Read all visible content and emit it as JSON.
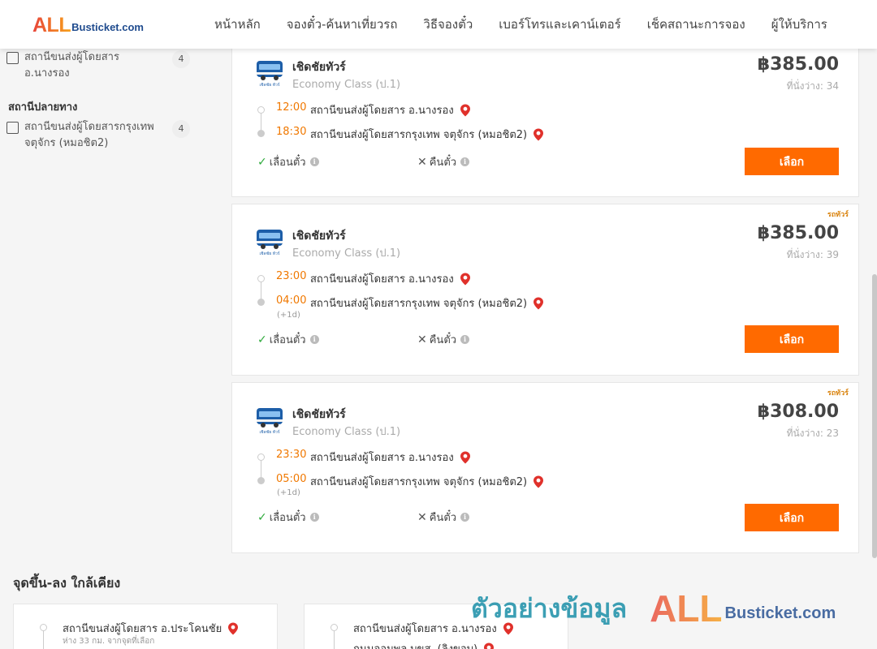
{
  "header": {
    "logo_all": "ALL",
    "logo_rest": "Busticket.com",
    "nav": [
      "หน้าหลัก",
      "จองตั๋ว-ค้นหาเที่ยวรถ",
      "วิธีจองตั๋ว",
      "เบอร์โทรและเคาน์เตอร์",
      "เช็คสถานะการจอง",
      "ผู้ให้บริการ"
    ]
  },
  "sidebar": {
    "origin_filter": {
      "label": "สถานีขนส่งผู้โดยสาร อ.นางรอง",
      "count": "4"
    },
    "destination_heading": "สถานีปลายทาง",
    "destination_filter": {
      "label": "สถานีขนส่งผู้โดยสารกรุงเทพ จตุจักร (หมอชิต2)",
      "count": "4"
    }
  },
  "trips": [
    {
      "tag": "",
      "operator": "เชิดชัยทัวร์",
      "bus_class": "Economy Class (ป.1)",
      "price": "฿385.00",
      "seats": "ที่นั่งว่าง: 34",
      "depart_time": "12:00",
      "depart_station": "สถานีขนส่งผู้โดยสาร อ.นางรอง",
      "arrive_time": "18:30",
      "arrive_station": "สถานีขนส่งผู้โดยสารกรุงเทพ จตุจักร (หมอชิต2)",
      "next_day": "",
      "reschedule": "เลื่อนตั๋ว",
      "refund": "คืนตั๋ว",
      "select": "เลือก"
    },
    {
      "tag": "รถทัวร์",
      "operator": "เชิดชัยทัวร์",
      "bus_class": "Economy Class (ป.1)",
      "price": "฿385.00",
      "seats": "ที่นั่งว่าง: 39",
      "depart_time": "23:00",
      "depart_station": "สถานีขนส่งผู้โดยสาร อ.นางรอง",
      "arrive_time": "04:00",
      "arrive_station": "สถานีขนส่งผู้โดยสารกรุงเทพ จตุจักร (หมอชิต2)",
      "next_day": "(+1d)",
      "reschedule": "เลื่อนตั๋ว",
      "refund": "คืนตั๋ว",
      "select": "เลือก"
    },
    {
      "tag": "รถทัวร์",
      "operator": "เชิดชัยทัวร์",
      "bus_class": "Economy Class (ป.1)",
      "price": "฿308.00",
      "seats": "ที่นั่งว่าง: 23",
      "depart_time": "23:30",
      "depart_station": "สถานีขนส่งผู้โดยสาร อ.นางรอง",
      "arrive_time": "05:00",
      "arrive_station": "สถานีขนส่งผู้โดยสารกรุงเทพ จตุจักร (หมอชิต2)",
      "next_day": "(+1d)",
      "reschedule": "เลื่อนตั๋ว",
      "refund": "คืนตั๋ว",
      "select": "เลือก"
    }
  ],
  "nearby": {
    "title": "จุดขึ้น-ลง ใกล้เคียง",
    "cards": [
      {
        "station": "สถานีขนส่งผู้โดยสาร อ.ประโคนชัย",
        "distance": "ห่าง 33 กม. จากจุดที่เลือก",
        "station2": ""
      },
      {
        "station": "สถานีขนส่งผู้โดยสาร อ.นางรอง",
        "distance": "",
        "station2": "ถนนจอมพล บขส. (ลิงขอบ)"
      }
    ]
  },
  "watermark": {
    "text": "ตัวอย่างข้อมูล",
    "all": "ALL",
    "rest": "Busticket.com"
  },
  "colors": {
    "accent": "#ff6a00",
    "time": "#f07800",
    "pin": "#e0312b",
    "check": "#2eaa3c"
  }
}
